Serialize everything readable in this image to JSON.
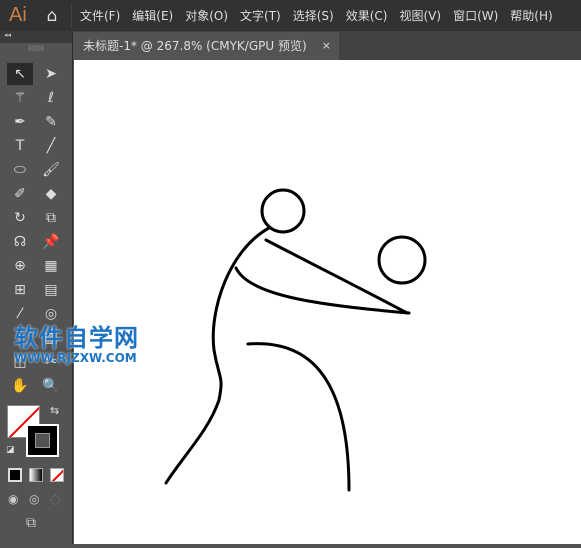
{
  "app": {
    "logo": "Ai",
    "home_icon": "home-icon"
  },
  "menu": [
    "文件(F)",
    "编辑(E)",
    "对象(O)",
    "文字(T)",
    "选择(S)",
    "效果(C)",
    "视图(V)",
    "窗口(W)",
    "帮助(H)"
  ],
  "panel": {
    "collapse": "◂◂",
    "grip": "||||||||"
  },
  "tab": {
    "title": "未标题-1* @ 267.8% (CMYK/GPU 预览)",
    "close": "×"
  },
  "watermark": {
    "line1": "软件自学网",
    "line2": "WWW.RJZXW.COM"
  },
  "colors": {
    "accent": "#c98046",
    "stroke": "#000000",
    "watermark": "#1e74c3"
  }
}
